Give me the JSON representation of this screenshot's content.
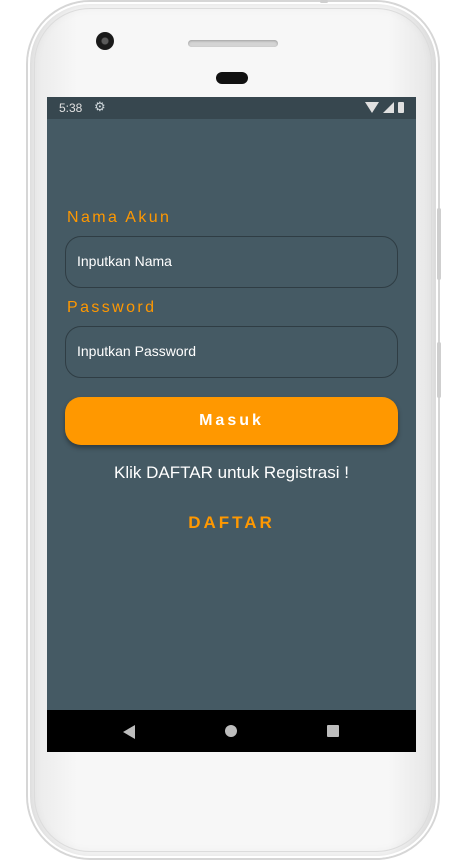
{
  "status_bar": {
    "time": "5:38",
    "icons": [
      "gear-icon",
      "wifi-icon",
      "signal-icon",
      "battery-icon"
    ]
  },
  "login_form": {
    "username_label": "Nama Akun",
    "username_placeholder": "Inputkan Nama",
    "password_label": "Password",
    "password_placeholder": "Inputkan Password",
    "login_button": "Masuk",
    "register_hint": "Klik DAFTAR untuk Registrasi !",
    "register_link": "DAFTAR"
  },
  "nav_bar": {
    "icons": [
      "back-icon",
      "home-icon",
      "recent-apps-icon"
    ]
  },
  "colors": {
    "background": "#455a64",
    "status_bar": "#37474f",
    "accent": "#ff9800",
    "text": "#ffffff",
    "nav_bar": "#000000"
  }
}
